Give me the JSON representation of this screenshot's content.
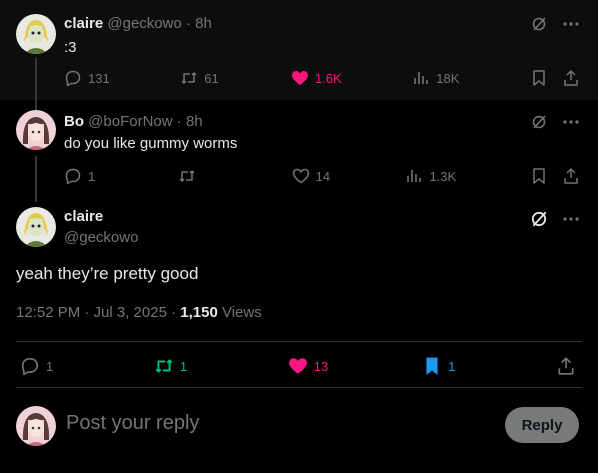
{
  "tweets": [
    {
      "name": "claire",
      "handle": "@geckowo",
      "time": "8h",
      "text": ":3",
      "replies": "131",
      "retweets": "61",
      "likes": "1.6K",
      "views": "18K"
    },
    {
      "name": "Bo",
      "handle": "@boForNow",
      "time": "8h",
      "text": "do you like gummy worms",
      "replies": "1",
      "retweets": "",
      "likes": "14",
      "views": "1.3K"
    }
  ],
  "main": {
    "name": "claire",
    "handle": "@geckowo",
    "text": "yeah they’re pretty good",
    "timestamp": "12:52 PM · Jul 3, 2025 · ",
    "views_count": "1,150",
    "views_label": " Views",
    "replies": "1",
    "retweets": "1",
    "likes": "13",
    "bookmarks": "1"
  },
  "reply_box": {
    "placeholder": "Post your reply",
    "button": "Reply"
  },
  "colors": {
    "like": "#f91880",
    "retweet": "#00ba7c",
    "bookmark": "#1d9bf0",
    "muted": "#71767b"
  }
}
